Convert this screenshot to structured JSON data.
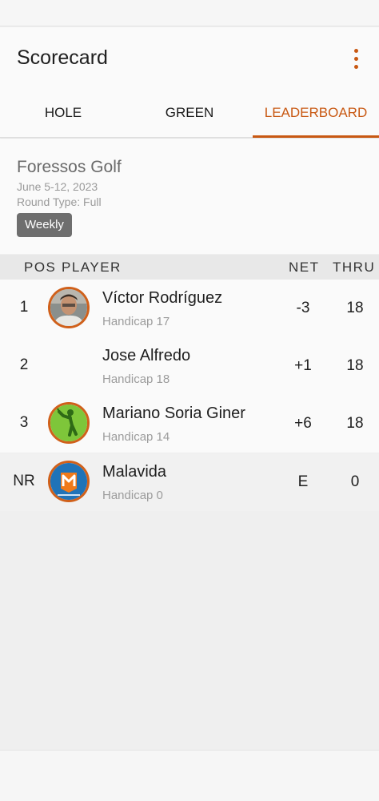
{
  "header": {
    "title": "Scorecard",
    "menu_icon": "more-vert-icon"
  },
  "tabs": [
    {
      "label": "HOLE",
      "active": false
    },
    {
      "label": "GREEN",
      "active": false
    },
    {
      "label": "LEADERBOARD",
      "active": true
    }
  ],
  "course": {
    "name": "Foressos Golf",
    "dates": "June 5-12, 2023",
    "round_type": "Round Type: Full",
    "filter_chip": "Weekly"
  },
  "table": {
    "col_pos": "POS",
    "col_player": "PLAYER",
    "col_net": "NET",
    "col_thru": "THRU",
    "rows": [
      {
        "pos": "1",
        "player": "Víctor Rodríguez",
        "handicap": "Handicap 17",
        "net": "-3",
        "thru": "18",
        "avatar": "photo-avatar"
      },
      {
        "pos": "2",
        "player": "Jose Alfredo",
        "handicap": "Handicap 18",
        "net": "+1",
        "thru": "18",
        "avatar": "none"
      },
      {
        "pos": "3",
        "player": "Mariano Soria Giner",
        "handicap": "Handicap 14",
        "net": "+6",
        "thru": "18",
        "avatar": "golfer-avatar"
      },
      {
        "pos": "NR",
        "player": "Malavida",
        "handicap": "Handicap 0",
        "net": "E",
        "thru": "0",
        "avatar": "malavida-logo"
      }
    ]
  },
  "colors": {
    "accent": "#c85812",
    "chip_bg": "#6e6e6e"
  }
}
